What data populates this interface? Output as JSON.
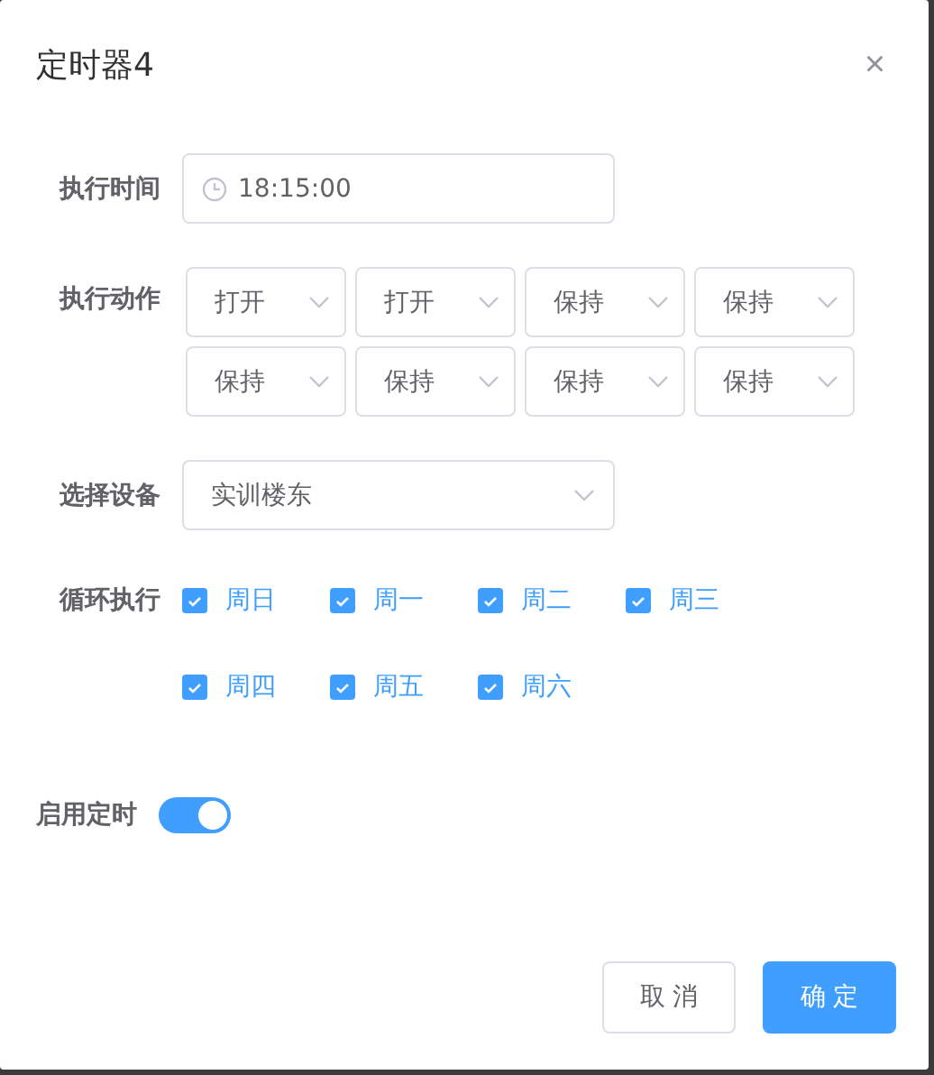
{
  "dialog": {
    "title": "定时器4",
    "close": "×"
  },
  "time": {
    "label": "执行时间",
    "value": "18:15:00"
  },
  "actions": {
    "label": "执行动作",
    "items": [
      {
        "value": "打开"
      },
      {
        "value": "打开"
      },
      {
        "value": "保持"
      },
      {
        "value": "保持"
      },
      {
        "value": "保持"
      },
      {
        "value": "保持"
      },
      {
        "value": "保持"
      },
      {
        "value": "保持"
      }
    ]
  },
  "device": {
    "label": "选择设备",
    "value": "实训楼东"
  },
  "repeat": {
    "label": "循环执行",
    "days": [
      {
        "label": "周日",
        "checked": true
      },
      {
        "label": "周一",
        "checked": true
      },
      {
        "label": "周二",
        "checked": true
      },
      {
        "label": "周三",
        "checked": true
      },
      {
        "label": "周四",
        "checked": true
      },
      {
        "label": "周五",
        "checked": true
      },
      {
        "label": "周六",
        "checked": true
      }
    ]
  },
  "enable": {
    "label": "启用定时",
    "on": true
  },
  "buttons": [
    {
      "label": "取 消",
      "kind": "default"
    },
    {
      "label": "确 定",
      "kind": "primary"
    }
  ]
}
